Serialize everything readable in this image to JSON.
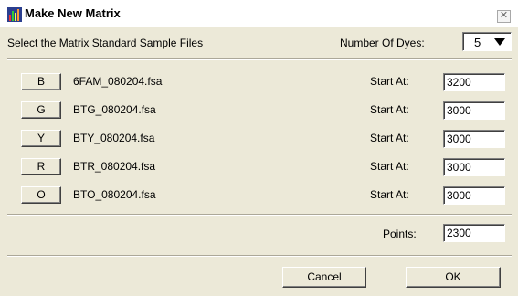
{
  "window": {
    "title": "Make New Matrix",
    "close_glyph": "✕"
  },
  "header": {
    "instruction": "Select the Matrix Standard Sample Files",
    "dyes_label": "Number Of Dyes:",
    "dyes_value": "5"
  },
  "rows": [
    {
      "dye": "B",
      "file": "6FAM_080204.fsa",
      "start_label": "Start At:",
      "start_value": "3200"
    },
    {
      "dye": "G",
      "file": "BTG_080204.fsa",
      "start_label": "Start At:",
      "start_value": "3000"
    },
    {
      "dye": "Y",
      "file": "BTY_080204.fsa",
      "start_label": "Start At:",
      "start_value": "3000"
    },
    {
      "dye": "R",
      "file": "BTR_080204.fsa",
      "start_label": "Start At:",
      "start_value": "3000"
    },
    {
      "dye": "O",
      "file": "BTO_080204.fsa",
      "start_label": "Start At:",
      "start_value": "3000"
    }
  ],
  "points": {
    "label": "Points:",
    "value": "2300"
  },
  "buttons": {
    "cancel": "Cancel",
    "ok": "OK"
  }
}
